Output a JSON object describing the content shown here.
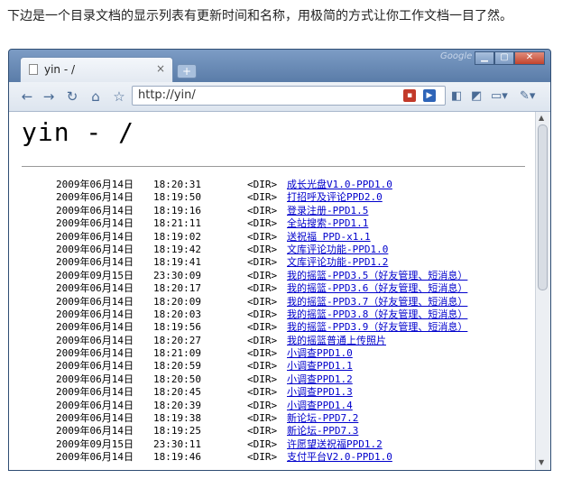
{
  "caption": "下边是一个目录文档的显示列表有更新时间和名称，用极简的方式让你工作文档一目了然。",
  "browser": {
    "tab_title": "yin - /",
    "tab_close": "×",
    "new_tab": "+",
    "brand": "Google",
    "address": "http://yin/",
    "icons": [
      "back-icon",
      "forward-icon",
      "reload-icon",
      "home-icon",
      "star-icon",
      "page-menu-icon",
      "wrench-icon"
    ]
  },
  "page": {
    "heading": "yin - /",
    "rows": [
      {
        "date": "2009年06月14日",
        "time": "18:20:31",
        "type": "<DIR>",
        "name": "成长光盘V1.0-PPD1.0"
      },
      {
        "date": "2009年06月14日",
        "time": "18:19:50",
        "type": "<DIR>",
        "name": "打招呼及评论PPD2.0"
      },
      {
        "date": "2009年06月14日",
        "time": "18:19:16",
        "type": "<DIR>",
        "name": "登录注册-PPD1.5"
      },
      {
        "date": "2009年06月14日",
        "time": "18:21:11",
        "type": "<DIR>",
        "name": "全站搜索-PPD1.1"
      },
      {
        "date": "2009年06月14日",
        "time": "18:19:02",
        "type": "<DIR>",
        "name": "送祝福 PPD-x1.1"
      },
      {
        "date": "2009年06月14日",
        "time": "18:19:42",
        "type": "<DIR>",
        "name": "文库评论功能-PPD1.0"
      },
      {
        "date": "2009年06月14日",
        "time": "18:19:41",
        "type": "<DIR>",
        "name": "文库评论功能-PPD1.2"
      },
      {
        "date": "2009年09月15日",
        "time": "23:30:09",
        "type": "<DIR>",
        "name": "我的摇篮-PPD3.5（好友管理、短消息）"
      },
      {
        "date": "2009年06月14日",
        "time": "18:20:17",
        "type": "<DIR>",
        "name": "我的摇篮-PPD3.6（好友管理、短消息）"
      },
      {
        "date": "2009年06月14日",
        "time": "18:20:09",
        "type": "<DIR>",
        "name": "我的摇篮-PPD3.7（好友管理、短消息）"
      },
      {
        "date": "2009年06月14日",
        "time": "18:20:03",
        "type": "<DIR>",
        "name": "我的摇篮-PPD3.8（好友管理、短消息）"
      },
      {
        "date": "2009年06月14日",
        "time": "18:19:56",
        "type": "<DIR>",
        "name": "我的摇篮-PPD3.9（好友管理、短消息）"
      },
      {
        "date": "2009年06月14日",
        "time": "18:20:27",
        "type": "<DIR>",
        "name": "我的摇篮普通上传照片"
      },
      {
        "date": "2009年06月14日",
        "time": "18:21:09",
        "type": "<DIR>",
        "name": "小调查PPD1.0"
      },
      {
        "date": "2009年06月14日",
        "time": "18:20:59",
        "type": "<DIR>",
        "name": "小调查PPD1.1"
      },
      {
        "date": "2009年06月14日",
        "time": "18:20:50",
        "type": "<DIR>",
        "name": "小调查PPD1.2"
      },
      {
        "date": "2009年06月14日",
        "time": "18:20:45",
        "type": "<DIR>",
        "name": "小调查PPD1.3"
      },
      {
        "date": "2009年06月14日",
        "time": "18:20:39",
        "type": "<DIR>",
        "name": "小调查PPD1.4"
      },
      {
        "date": "2009年06月14日",
        "time": "18:19:38",
        "type": "<DIR>",
        "name": "新论坛-PPD7.2"
      },
      {
        "date": "2009年06月14日",
        "time": "18:19:25",
        "type": "<DIR>",
        "name": "新论坛-PPD7.3"
      },
      {
        "date": "2009年09月15日",
        "time": "23:30:11",
        "type": "<DIR>",
        "name": "许愿望送祝福PPD1.2"
      },
      {
        "date": "2009年06月14日",
        "time": "18:19:46",
        "type": "<DIR>",
        "name": "支付平台V2.0-PPD1.0"
      }
    ]
  }
}
